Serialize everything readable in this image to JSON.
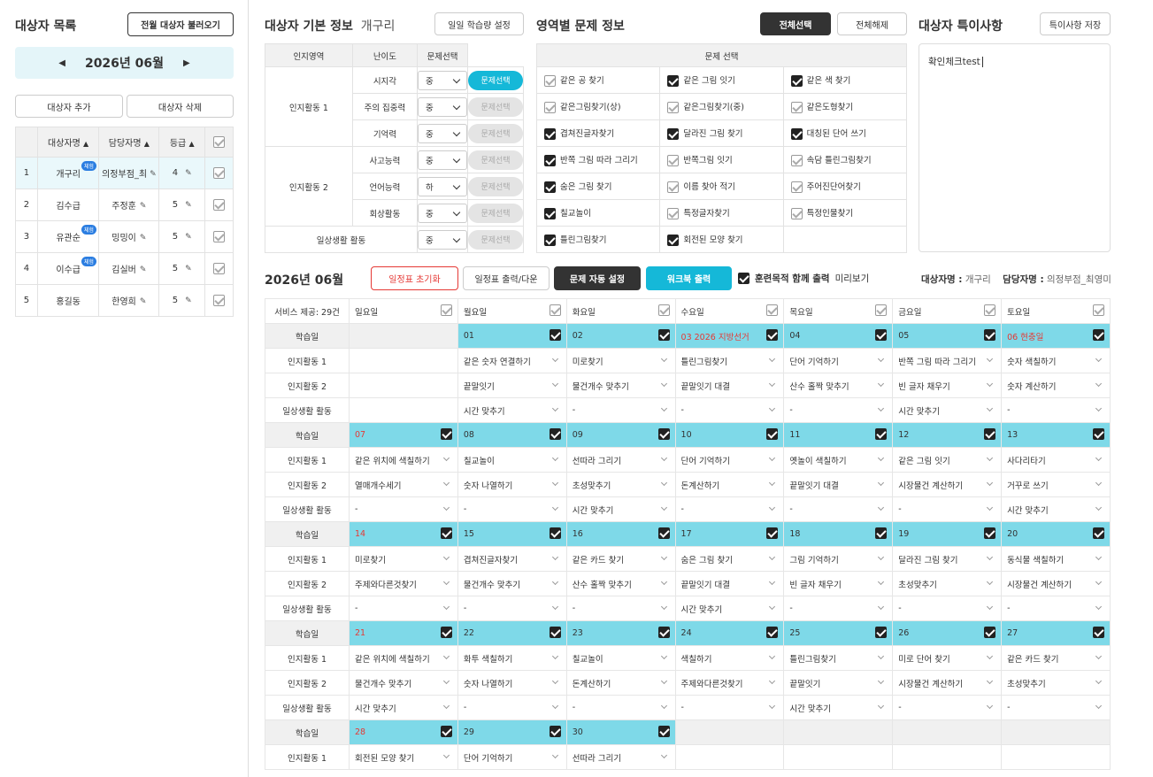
{
  "left": {
    "title": "대상자 목록",
    "load_btn": "전월 대상자 불러오기",
    "month": "2026년 06월",
    "add_btn": "대상자 추가",
    "del_btn": "대상자 삭제",
    "cols": [
      "대상자명",
      "담당자명",
      "등급"
    ],
    "rows": [
      {
        "no": "1",
        "name": "개구리",
        "badge": "체험",
        "mgr": "의정부점_최영",
        "grade": "4"
      },
      {
        "no": "2",
        "name": "김수급",
        "badge": "",
        "mgr": "주정훈",
        "grade": "5"
      },
      {
        "no": "3",
        "name": "유관순",
        "badge": "체험",
        "mgr": "밍밍이",
        "grade": "5"
      },
      {
        "no": "4",
        "name": "이수급",
        "badge": "체험",
        "mgr": "김실버",
        "grade": "5"
      },
      {
        "no": "5",
        "name": "홍길동",
        "badge": "",
        "mgr": "한영희",
        "grade": "5"
      }
    ]
  },
  "info": {
    "title": "대상자 기본 정보",
    "name": "개구리",
    "daily_btn": "일일 학습량 설정",
    "cols": [
      "인지영역",
      "난이도",
      "문제선택"
    ],
    "pill": "문제선택",
    "groups": [
      {
        "g": "인지활동 1",
        "items": [
          {
            "n": "시지각",
            "lv": "중"
          },
          {
            "n": "주의 집중력",
            "lv": "중"
          },
          {
            "n": "기억력",
            "lv": "중"
          }
        ]
      },
      {
        "g": "인지활동 2",
        "items": [
          {
            "n": "사고능력",
            "lv": "중"
          },
          {
            "n": "언어능력",
            "lv": "하"
          },
          {
            "n": "회상활동",
            "lv": "중"
          }
        ]
      }
    ],
    "daily": {
      "n": "일상생활 활동",
      "lv": "중"
    }
  },
  "problems": {
    "title": "영역별 문제 정보",
    "all_btn": "전체선택",
    "none_btn": "전체해제",
    "header": "문제 선택",
    "rows": [
      [
        [
          "같은 공 찾기",
          0
        ],
        [
          "같은 그림 잇기",
          1
        ],
        [
          "같은 색 찾기",
          1
        ]
      ],
      [
        [
          "같은그림찾기(상)",
          0
        ],
        [
          "같은그림찾기(중)",
          0
        ],
        [
          "같은도형찾기",
          0
        ]
      ],
      [
        [
          "겹쳐진글자찾기",
          1
        ],
        [
          "달라진 그림 찾기",
          1
        ],
        [
          "대칭된 단어 쓰기",
          1
        ]
      ],
      [
        [
          "반쪽 그림 따라 그리기",
          1
        ],
        [
          "반쪽그림 잇기",
          0
        ],
        [
          "속담 틀린그림찾기",
          0
        ]
      ],
      [
        [
          "숨은 그림 찾기",
          1
        ],
        [
          "이름 찾아 적기",
          0
        ],
        [
          "주어진단어찾기",
          0
        ]
      ],
      [
        [
          "칠교놀이",
          1
        ],
        [
          "특정글자찾기",
          0
        ],
        [
          "특정인물찾기",
          0
        ]
      ],
      [
        [
          "틀린그림찾기",
          1
        ],
        [
          "회전된 모양 찾기",
          1
        ],
        [
          "",
          0
        ]
      ]
    ]
  },
  "notes": {
    "title": "대상자 특이사항",
    "save_btn": "특이사항 저장",
    "text": "확인체크test"
  },
  "sched": {
    "month": "2026년 06월",
    "reset_btn": "일정표 초기화",
    "print_btn": "일정표 출력/다운",
    "auto_btn": "문제 자동 설정",
    "work_btn": "워크북 출력",
    "purpose": "훈련목적 함께 출력",
    "preview": "미리보기",
    "subj_label": "대상자명 :",
    "subj": "개구리",
    "mgr_label": "담당자명 :",
    "mgr": "의정부점_최영미",
    "svc": "서비스 제공: 29건",
    "days": [
      "일요일",
      "월요일",
      "화요일",
      "수요일",
      "목요일",
      "금요일",
      "토요일"
    ],
    "row_labels": [
      "학습일",
      "인지활동 1",
      "인지활동 2",
      "일상생활 활동"
    ],
    "weeks": [
      {
        "d": [
          "",
          "01",
          "02",
          "03 2026 지방선거",
          "04",
          "05",
          "06 현충일"
        ],
        "red": [
          0,
          0,
          0,
          1,
          0,
          0,
          1
        ],
        "a1": [
          "",
          "같은 숫자 연결하기",
          "미로찾기",
          "틀린그림찾기",
          "단어 기억하기",
          "반쪽 그림 따라 그리기",
          "숫자 색칠하기"
        ],
        "a2": [
          "",
          "끝말잇기",
          "물건개수 맞추기",
          "끝말잇기 대결",
          "산수 홀짝 맞추기",
          "빈 글자 채우기",
          "숫자 계산하기"
        ],
        "a3": [
          "",
          "시간 맞추기",
          "-",
          "-",
          "-",
          "시간 맞추기",
          "-"
        ]
      },
      {
        "d": [
          "07",
          "08",
          "09",
          "10",
          "11",
          "12",
          "13"
        ],
        "red": [
          1,
          0,
          0,
          0,
          0,
          0,
          0
        ],
        "a1": [
          "같은 위치에 색칠하기",
          "칠교놀이",
          "선따라 그리기",
          "단어 기억하기",
          "옛놀이 색칠하기",
          "같은 그림 잇기",
          "사다리타기"
        ],
        "a2": [
          "열매개수세기",
          "숫자 나열하기",
          "초성맞추기",
          "돈계산하기",
          "끝말잇기 대결",
          "시장물건 계산하기",
          "거꾸로 쓰기"
        ],
        "a3": [
          "-",
          "-",
          "시간 맞추기",
          "-",
          "-",
          "-",
          "시간 맞추기"
        ]
      },
      {
        "d": [
          "14",
          "15",
          "16",
          "17",
          "18",
          "19",
          "20"
        ],
        "red": [
          1,
          0,
          0,
          0,
          0,
          0,
          0
        ],
        "a1": [
          "미로찾기",
          "겹쳐진글자찾기",
          "같은 카드 찾기",
          "숨은 그림 찾기",
          "그림 기억하기",
          "달라진 그림 찾기",
          "동식물 색칠하기"
        ],
        "a2": [
          "주제와다른것찾기",
          "물건개수 맞추기",
          "산수 홀짝 맞추기",
          "끝말잇기 대결",
          "빈 글자 채우기",
          "초성맞추기",
          "시장물건 계산하기"
        ],
        "a3": [
          "-",
          "-",
          "-",
          "시간 맞추기",
          "-",
          "-",
          "-"
        ]
      },
      {
        "d": [
          "21",
          "22",
          "23",
          "24",
          "25",
          "26",
          "27"
        ],
        "red": [
          1,
          0,
          0,
          0,
          0,
          0,
          0
        ],
        "a1": [
          "같은 위치에 색칠하기",
          "화투 색칠하기",
          "칠교놀이",
          "색칠하기",
          "틀린그림찾기",
          "미로 단어 찾기",
          "같은 카드 찾기"
        ],
        "a2": [
          "물건개수 맞추기",
          "숫자 나열하기",
          "돈계산하기",
          "주제와다른것찾기",
          "끝말잇기",
          "시장물건 계산하기",
          "초성맞추기"
        ],
        "a3": [
          "시간 맞추기",
          "-",
          "-",
          "-",
          "시간 맞추기",
          "-",
          "-"
        ]
      },
      {
        "d": [
          "28",
          "29",
          "30",
          "",
          "",
          "",
          ""
        ],
        "red": [
          1,
          0,
          0,
          0,
          0,
          0,
          0
        ],
        "a1": [
          "회전된 모양 찾기",
          "단어 기억하기",
          "선따라 그리기",
          "",
          "",
          "",
          ""
        ]
      }
    ]
  },
  "colors": {
    "accent": "#15b8d8",
    "dayrow": "#7ed9e8",
    "dark": "#333333",
    "red": "#e53935"
  }
}
